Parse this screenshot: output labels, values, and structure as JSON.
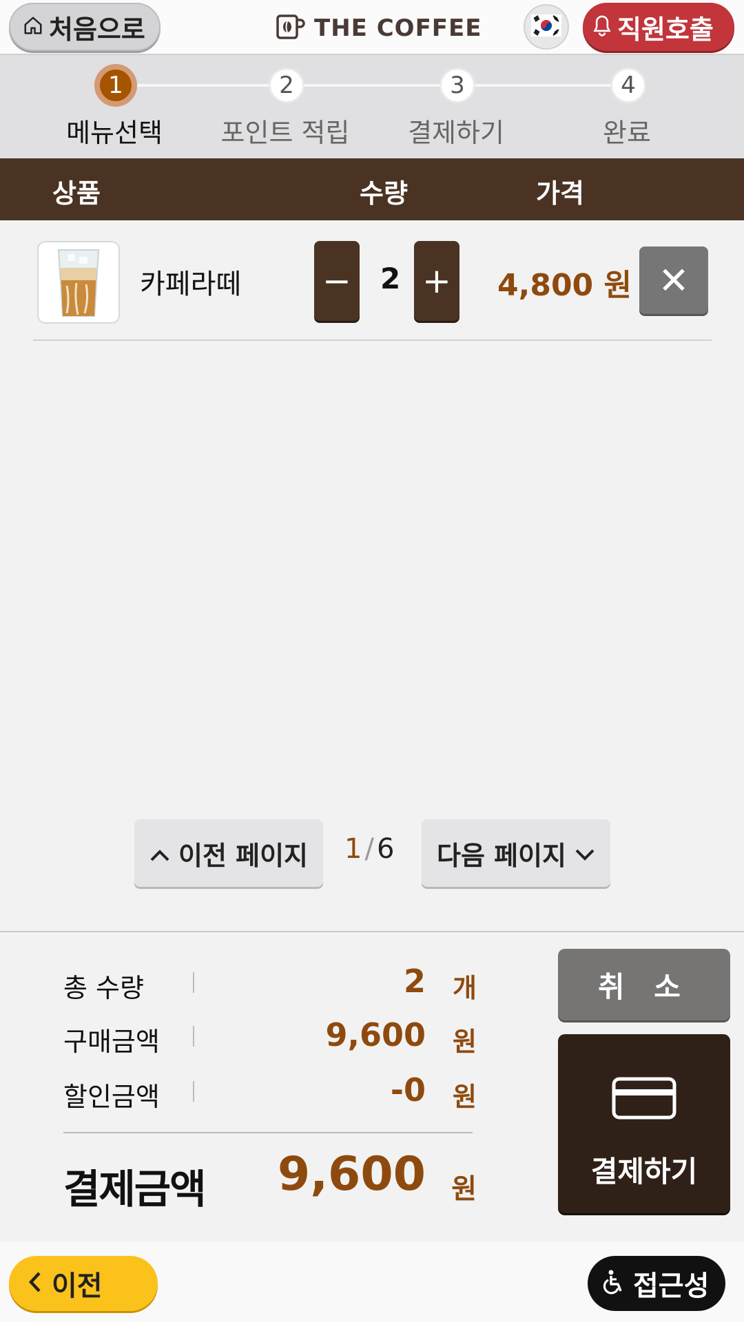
{
  "header": {
    "home_label": "처음으로",
    "brand": "THE COFFEE",
    "staff_call_label": "직원호출",
    "language_flag": "korean-flag"
  },
  "steps": [
    {
      "number": "1",
      "label": "메뉴선택",
      "active": true
    },
    {
      "number": "2",
      "label": "포인트 적립",
      "active": false
    },
    {
      "number": "3",
      "label": "결제하기",
      "active": false
    },
    {
      "number": "4",
      "label": "완료",
      "active": false
    }
  ],
  "table": {
    "headers": {
      "product": "상품",
      "quantity": "수량",
      "price": "가격"
    },
    "items": [
      {
        "name": "카페라떼",
        "image": "iced-cafe-latte",
        "quantity": "2",
        "price": "4,800 원"
      }
    ]
  },
  "pager": {
    "prev_label": "이전 페이지",
    "next_label": "다음 페이지",
    "current": "1",
    "total": "6"
  },
  "summary": {
    "total_qty_label": "총 수량",
    "total_qty_value": "2",
    "total_qty_unit": "개",
    "purchase_label": "구매금액",
    "purchase_value": "9,600",
    "purchase_unit": "원",
    "discount_label": "할인금액",
    "discount_value": "-0",
    "discount_unit": "원",
    "pay_total_label": "결제금액",
    "pay_total_value": "9,600",
    "pay_total_unit": "원"
  },
  "actions": {
    "cancel_label": "취 소",
    "pay_label": "결제하기"
  },
  "footer": {
    "prev_label": "이전",
    "accessibility_label": "접근성"
  },
  "colors": {
    "brown_dark": "#4a3323",
    "accent_price": "#8e4a0e",
    "staff_red": "#c1353b",
    "prev_yellow": "#fcc21c"
  }
}
